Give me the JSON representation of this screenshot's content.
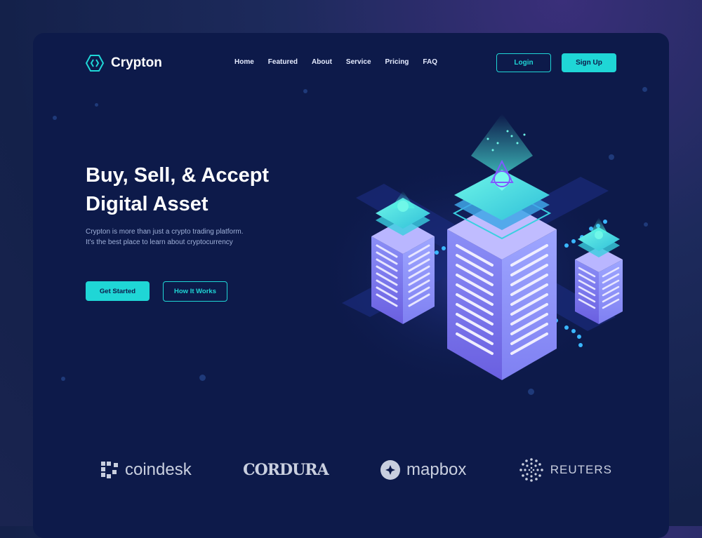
{
  "brand": {
    "name": "Crypton"
  },
  "nav": {
    "items": [
      {
        "label": "Home"
      },
      {
        "label": "Featured"
      },
      {
        "label": "About"
      },
      {
        "label": "Service"
      },
      {
        "label": "Pricing"
      },
      {
        "label": "FAQ"
      }
    ],
    "login_label": "Login",
    "signup_label": "Sign Up"
  },
  "hero": {
    "title_line1": "Buy, Sell, & Accept",
    "title_line2": "Digital Asset",
    "desc_line1": "Crypton is more than just a crypto trading platform.",
    "desc_line2": "It's the best place to learn about cryptocurrency",
    "primary_cta": "Get Started",
    "secondary_cta": "How It Works"
  },
  "partners": [
    {
      "name": "coindesk",
      "icon": "coindesk-icon"
    },
    {
      "name": "CORDURA",
      "icon": "cordura-wordmark"
    },
    {
      "name": "mapbox",
      "icon": "mapbox-icon"
    },
    {
      "name": "REUTERS",
      "icon": "reuters-icon"
    }
  ],
  "colors": {
    "accent": "#1fd6d6",
    "background": "#0d1a4a",
    "server": "#7b7ff0"
  }
}
